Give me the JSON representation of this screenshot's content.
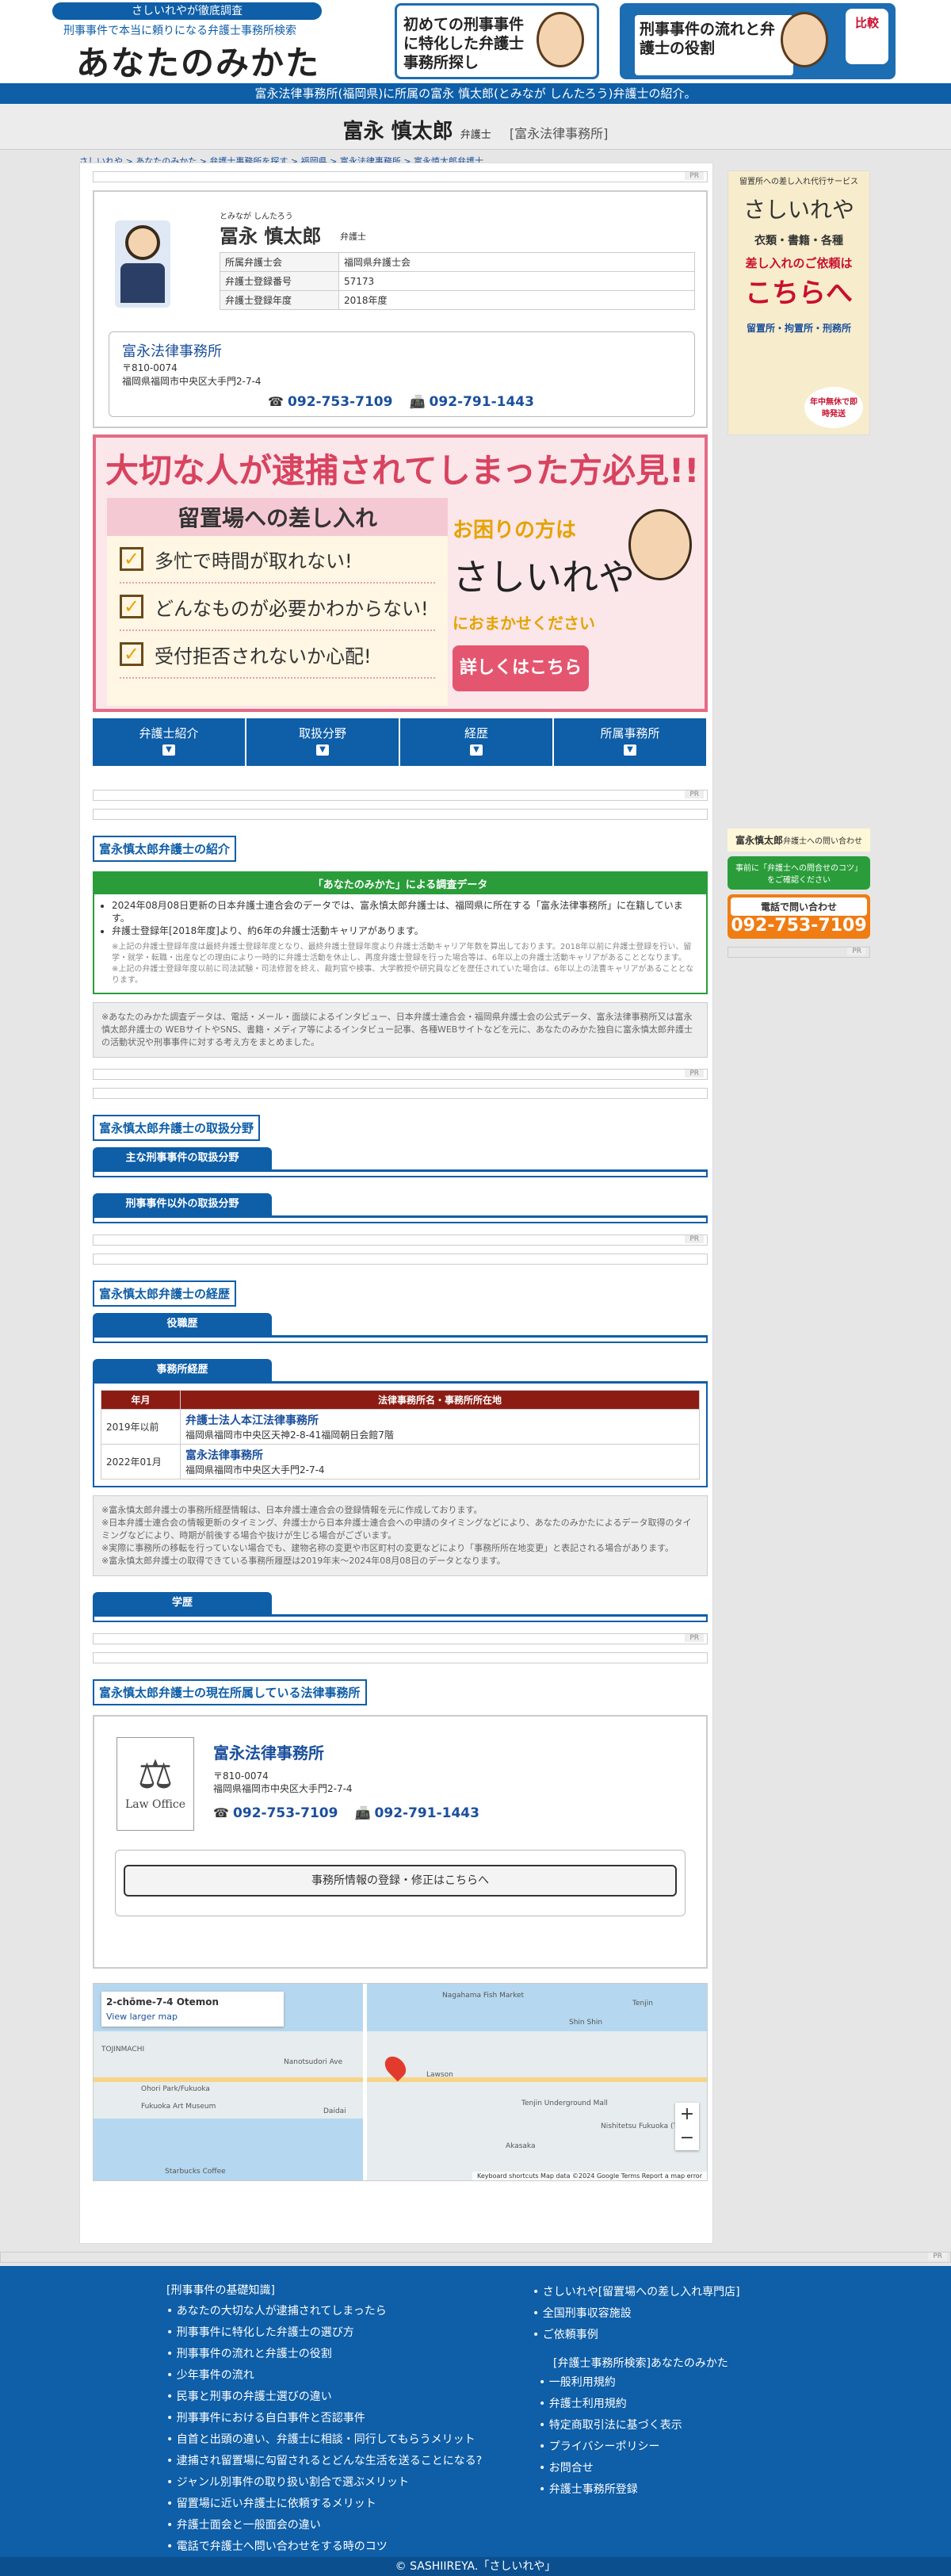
{
  "header": {
    "tag": "さしいれやが徹底調査",
    "sub": "刑事事件で本当に頼りになる弁護士事務所検索",
    "logo": "あなたのみかた",
    "btn1": "初めての刑事事件に特化した弁護士事務所探し",
    "btn2": "刑事事件の流れと弁護士の役割",
    "btn2_badge": "比較"
  },
  "bluebar": "富永法律事務所(福岡県)に所属の富永 慎太郎(とみなが しんたろう)弁護士の紹介。",
  "namebar": {
    "name": "富永 慎太郎",
    "suffix": "弁護士",
    "office": "[富永法律事務所]"
  },
  "breadcrumb": "さしいれや > あなたのみかた > 弁護士事務所を探す > 福岡県 > 富永法律事務所 > 富永慎太郎弁護士",
  "pr": "PR",
  "profile": {
    "kana": "とみなが しんたろう",
    "name": "冨永 慎太郎",
    "suffix": "弁護士",
    "rows": [
      {
        "k": "所属弁護士会",
        "v": "福岡県弁護士会"
      },
      {
        "k": "弁護士登録番号",
        "v": "57173"
      },
      {
        "k": "弁護士登録年度",
        "v": "2018年度"
      }
    ],
    "office": "富永法律事務所",
    "zip": "〒810-0074",
    "addr": "福岡県福岡市中央区大手門2-7-4",
    "tel": "092-753-7109",
    "fax": "092-791-1443"
  },
  "banner": {
    "title": "大切な人が逮捕されてしまった方必見!!",
    "sub": "留置場への差し入れ",
    "items": [
      "多忙で時間が取れない!",
      "どんなものが必要かわからない!",
      "受付拒否されないか心配!"
    ],
    "help": "お困りの方は",
    "brand": "さしいれや",
    "cta": "におまかせください",
    "btn": "詳しくはこちら"
  },
  "tabs": [
    "弁護士紹介",
    "取扱分野",
    "経歴",
    "所属事務所"
  ],
  "intro": {
    "h": "富永慎太郎弁護士の紹介",
    "survey": "「あなたのみかた」による調査データ",
    "li1": "2024年08月08日更新の日本弁護士連合会のデータでは、富永慎太郎弁護士は、福岡県に所在する「富永法律事務所」に在籍しています。",
    "li2": "弁護士登録年[2018年度]より、約6年の弁護士活動キャリアがあります。",
    "small": "※上記の弁護士登録年度は最終弁護士登録年度となり、最終弁護士登録年度より弁護士活動キャリア年数を算出しております。2018年以前に弁護士登録を行い、留学・就学・転職・出産などの理由により一時的に弁護士活動を休止し、再度弁護士登録を行った場合等は、6年以上の弁護士活動キャリアがあることとなります。\n※上記の弁護士登録年度以前に司法試験・司法修習を終え、裁判官や検事、大学教授や研究員などを歴任されていた場合は、6年以上の法曹キャリアがあることとなります。",
    "note": "※あなたのみかた調査データは、電話・メール・面談によるインタビュー、日本弁護士連合会・福岡県弁護士会の公式データ、富永法律事務所又は富永慎太郎弁護士の WEBサイトやSNS、書籍・メディア等によるインタビュー記事、各種WEBサイトなどを元に、あなたのみかた独自に富永慎太郎弁護士の活動状況や刑事事件に対する考え方をまとめました。"
  },
  "fields": {
    "h": "富永慎太郎弁護士の取扱分野",
    "t1": "主な刑事事件の取扱分野",
    "t2": "刑事事件以外の取扱分野"
  },
  "career": {
    "h": "富永慎太郎弁護士の経歴",
    "t1": "役職歴",
    "t2": "事務所経歴",
    "col1": "年月",
    "col2": "法律事務所名・事務所所在地",
    "rows": [
      {
        "y": "2019年以前",
        "n": "弁護士法人本江法律事務所",
        "a": "福岡県福岡市中央区天神2-8-41福岡朝日会館7階"
      },
      {
        "y": "2022年01月",
        "n": "富永法律事務所",
        "a": "福岡県福岡市中央区大手門2-7-4"
      }
    ],
    "note": "※富永慎太郎弁護士の事務所経歴情報は、日本弁護士連合会の登録情報を元に作成しております。\n※日本弁護士連合会の情報更新のタイミング、弁護士から日本弁護士連合会への申請のタイミングなどにより、あなたのみかたによるデータ取得のタイミングなどにより、時期が前後する場合や抜けが生じる場合がございます。\n※実際に事務所の移転を行っていない場合でも、建物名称の変更や市区町村の変更などにより「事務所所在地変更」と表記される場合があります。\n※富永慎太郎弁護士の取得できている事務所履歴は2019年末〜2024年08月08日のデータとなります。",
    "t3": "学歴"
  },
  "office": {
    "h": "富永慎太郎弁護士の現在所属している法律事務所",
    "logo": "Law Office",
    "name": "富永法律事務所",
    "zip": "〒810-0074",
    "addr": "福岡県福岡市中央区大手門2-7-4",
    "tel": "092-753-7109",
    "fax": "092-791-1443",
    "btn": "事務所情報の登録・修正はこちらへ"
  },
  "map": {
    "place": "2-chōme-7-4 Otemon",
    "link": "View larger map",
    "labels": [
      "Nagahama Fish Market",
      "Shin Shin",
      "Tenjin",
      "Lawson",
      "Nanotsudori Ave",
      "Fukuoka Art Museum",
      "Ohori Park/Fukuoka",
      "Tenjin Underground Mall",
      "Nishitetsu Fukuoka (Tenjin)",
      "Akasaka",
      "Starbucks Coffee",
      "Daidai",
      "TOJINMACHI"
    ],
    "footer": "Keyboard shortcuts   Map data ©2024 Google   Terms   Report a map error"
  },
  "side": {
    "ad_top": "留置所への差し入れ代行サービス",
    "ad_brand": "さしいれや",
    "ad_items": "衣類・書籍・各種",
    "ad_cta1": "差し入れのご依頼は",
    "ad_cta2": "こちらへ",
    "ad_places": "留置所・拘置所・刑務所",
    "ad_badge": "年中無休で即時発送",
    "name": "富永慎太郎",
    "name_suf": "弁護士への問い合わせ",
    "green": "事前に「弁護士への問合せのコツ」をご確認ください",
    "call": "電話で問い合わせ",
    "tel": "092-753-7109"
  },
  "footer": {
    "col1_head": "[刑事事件の基礎知識]",
    "col1": [
      "あなたの大切な人が逮捕されてしまったら",
      "刑事事件に特化した弁護士の選び方",
      "刑事事件の流れと弁護士の役割",
      "少年事件の流れ",
      "民事と刑事の弁護士選びの違い",
      "刑事事件における自白事件と否認事件",
      "自首と出頭の違い、弁護士に相談・同行してもらうメリット",
      "逮捕され留置場に勾留されるとどんな生活を送ることになる?",
      "ジャンル別事件の取り扱い割合で選ぶメリット",
      "留置場に近い弁護士に依頼するメリット",
      "弁護士面会と一般面会の違い",
      "電話で弁護士へ問い合わせをする時のコツ"
    ],
    "col2": [
      "さしいれや[留置場への差し入れ専門店]",
      "全国刑事収容施設",
      "ご依頼事例"
    ],
    "col2_head": "[弁護士事務所検索]あなたのみかた",
    "col3": [
      "一般利用規約",
      "弁護士利用規約",
      "特定商取引法に基づく表示",
      "プライバシーポリシー",
      "お問合せ",
      "弁護士事務所登録"
    ],
    "copy": "© SASHIIREYA.「さしいれや」"
  },
  "colors": {
    "brand": "#0e5ea8",
    "red": "#c8102e",
    "green": "#2a9d3a"
  }
}
